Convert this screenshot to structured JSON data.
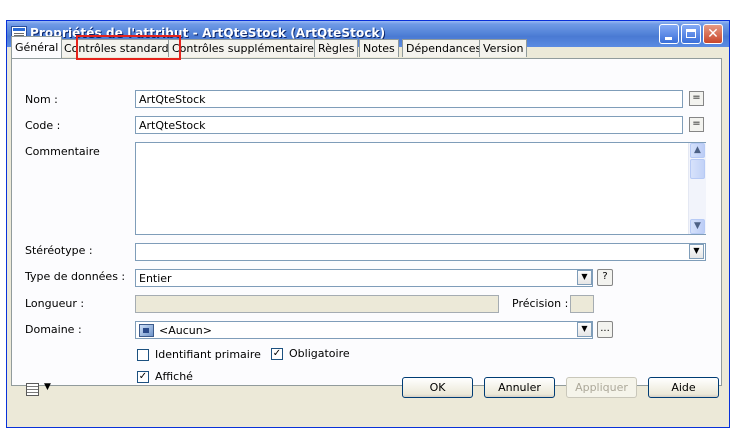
{
  "window": {
    "title": "Propriétés de l'attribut - ArtQteStock (ArtQteStock)",
    "close_glyph": "✕"
  },
  "tabs": [
    {
      "label": "Général"
    },
    {
      "label": "Contrôles standard"
    },
    {
      "label": "Contrôles supplémentaires"
    },
    {
      "label": "Règles"
    },
    {
      "label": "Notes"
    },
    {
      "label": "Dépendances"
    },
    {
      "label": "Version"
    }
  ],
  "form": {
    "nom_label": "Nom :",
    "nom_value": "ArtQteStock",
    "code_label": "Code :",
    "code_value": "ArtQteStock",
    "eq_glyph": "=",
    "comment_label": "Commentaire",
    "comment_value": "",
    "stereotype_label": "Stéréotype :",
    "stereotype_value": "",
    "datatype_label": "Type de données :",
    "datatype_value": "Entier",
    "help_glyph": "?",
    "length_label": "Longueur :",
    "length_value": "",
    "precision_label": "Précision :",
    "precision_value": "",
    "domain_label": "Domaine :",
    "domain_value": "<Aucun>",
    "ellipsis_glyph": "...",
    "dropdown_glyph": "▼",
    "scroll_up_glyph": "▲",
    "scroll_down_glyph": "▼",
    "check_mark": "✓",
    "checkboxes": {
      "primary": {
        "label": "Identifiant primaire",
        "checked": false
      },
      "mandatory": {
        "label": "Obligatoire",
        "checked": true
      },
      "displayed": {
        "label": "Affiché",
        "checked": true
      }
    }
  },
  "footer": {
    "menu_arrow": "▼",
    "ok": "OK",
    "cancel": "Annuler",
    "apply": "Appliquer",
    "help": "Aide"
  },
  "colors": {
    "highlight": "#e5221c",
    "title_bar": "#4a7ad3",
    "dialog_bg": "#ece9d8"
  }
}
